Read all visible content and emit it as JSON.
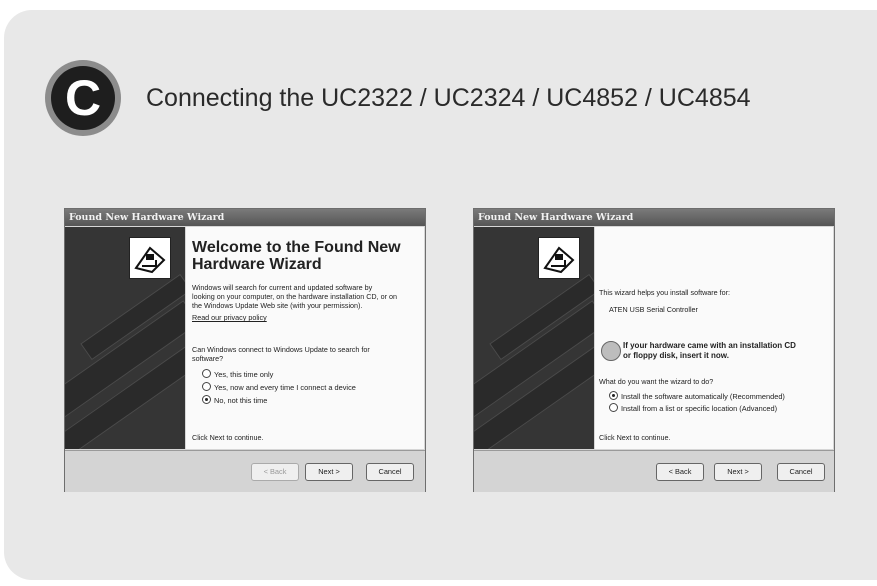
{
  "header": {
    "badge_letter": "C",
    "title": "Connecting the UC2322 / UC2324 / UC4852 / UC4854"
  },
  "left_window": {
    "title": "Found New Hardware Wizard",
    "heading_line1": "Welcome to the Found New",
    "heading_line2": "Hardware Wizard",
    "intro_line1": "Windows will search for current and updated software by",
    "intro_line2": "looking on your computer, on the hardware installation CD, or on",
    "intro_line3": "the Windows Update Web site (with your permission).",
    "privacy_link": "Read our privacy policy",
    "question_line1": "Can Windows connect to Windows Update to search for",
    "question_line2": "software?",
    "options": [
      {
        "label": "Yes, this time only",
        "selected": false
      },
      {
        "label": "Yes, now and every time I connect a device",
        "selected": false
      },
      {
        "label": "No, not this time",
        "selected": true
      }
    ],
    "footer_text": "Click Next to continue.",
    "buttons": {
      "back": "< Back",
      "next": "Next >",
      "cancel": "Cancel"
    }
  },
  "right_window": {
    "title": "Found New Hardware Wizard",
    "intro": "This wizard helps you install software for:",
    "device": "ATEN USB Serial Controller",
    "cd_note_line1": "If your hardware came with an installation CD",
    "cd_note_line2": "or floppy disk, insert it now.",
    "question": "What do you want the wizard to do?",
    "options": [
      {
        "label": "Install the software automatically (Recommended)",
        "selected": true
      },
      {
        "label": "Install from a list or specific location (Advanced)",
        "selected": false
      }
    ],
    "footer_text": "Click Next to continue.",
    "buttons": {
      "back": "< Back",
      "next": "Next >",
      "cancel": "Cancel"
    }
  }
}
